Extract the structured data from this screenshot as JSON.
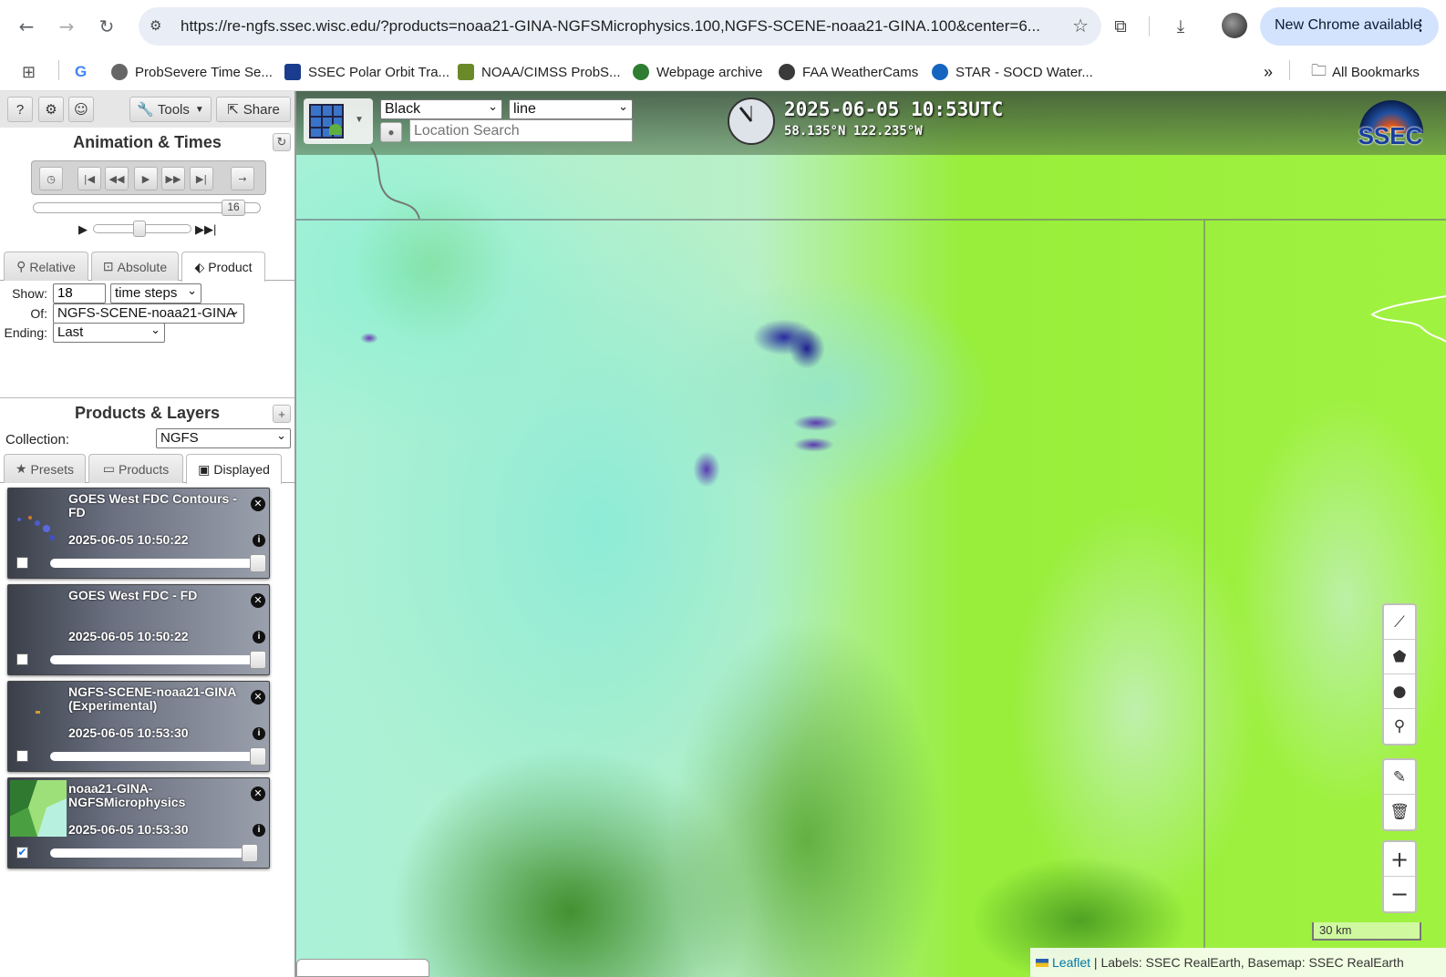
{
  "browser": {
    "url": "https://re-ngfs.ssec.wisc.edu/?products=noaa21-GINA-NGFSMicrophysics.100,NGFS-SCENE-noaa21-GINA.100&center=6...",
    "update_label": "New Chrome available",
    "bookmarks": [
      {
        "label": "ProbSevere Time Se...",
        "color": "#555"
      },
      {
        "label": "SSEC Polar Orbit Tra...",
        "color": "#1a3c8c"
      },
      {
        "label": "NOAA/CIMSS ProbS...",
        "color": "#6a8a2a"
      },
      {
        "label": "Webpage archive",
        "color": "#2e7d32"
      },
      {
        "label": "FAA WeatherCams",
        "color": "#3a3a3a"
      },
      {
        "label": "STAR - SOCD Water...",
        "color": "#1565c0"
      }
    ],
    "all_bookmarks_label": "All Bookmarks"
  },
  "toolbar": {
    "help_label": "?",
    "tools_label": "Tools",
    "share_label": "Share"
  },
  "animation": {
    "title": "Animation & Times",
    "frame_value": "16"
  },
  "time_tabs": [
    {
      "label": "Relative"
    },
    {
      "label": "Absolute"
    },
    {
      "label": "Product"
    }
  ],
  "product_form": {
    "show_label": "Show:",
    "show_value": "18",
    "show_unit": "time steps",
    "of_label": "Of:",
    "of_value": "NGFS-SCENE-noaa21-GINA",
    "ending_label": "Ending:",
    "ending_value": "Last"
  },
  "products": {
    "title": "Products & Layers",
    "collection_label": "Collection:",
    "collection_value": "NGFS",
    "tabs": [
      {
        "label": "Presets"
      },
      {
        "label": "Products"
      },
      {
        "label": "Displayed"
      }
    ]
  },
  "layers": [
    {
      "name": "GOES West FDC Contours - FD",
      "time": "2025-06-05 10:50:22",
      "checked": "",
      "level": 1.0
    },
    {
      "name": "GOES West FDC - FD",
      "time": "2025-06-05 10:50:22",
      "checked": "",
      "level": 1.0
    },
    {
      "name": "NGFS-SCENE-noaa21-GINA (Experimental)",
      "time": "2025-06-05 10:53:30",
      "checked": "",
      "level": 1.0
    },
    {
      "name": "noaa21-GINA-NGFSMicrophysics",
      "time": "2025-06-05 10:53:30",
      "checked": "✔",
      "level": 0.96
    }
  ],
  "map": {
    "color_select": "Black",
    "style_select": "line",
    "search_placeholder": "Location Search",
    "datetime": "2025-06-05 10:53UTC",
    "coords": "58.135°N 122.235°W",
    "logo_text": "SSEC",
    "scale_label": "30 km",
    "attribution_leaflet": "Leaflet",
    "attribution_rest": " | Labels: SSEC RealEarth, Basemap: SSEC RealEarth"
  }
}
